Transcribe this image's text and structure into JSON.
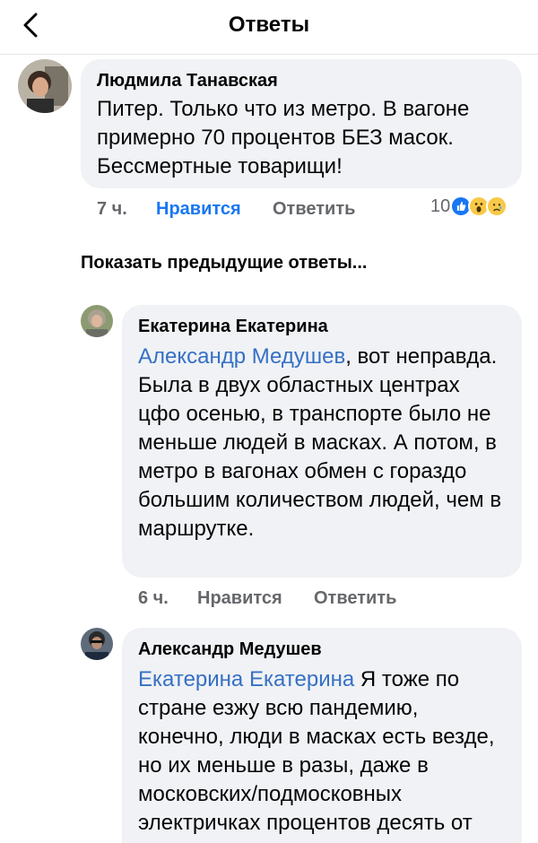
{
  "header": {
    "title": "Ответы",
    "back_icon": "chevron-left-icon"
  },
  "comments": [
    {
      "author": "Людмила Танавская",
      "text": "Питер. Только что из метро. В вагоне примерно 70 процентов БЕЗ масок. Бессмертные товарищи!",
      "time": "7 ч.",
      "like_label": "Нравится",
      "reply_label": "Ответить",
      "reactions_count": "10",
      "reactions": [
        "like",
        "wow",
        "sad"
      ]
    }
  ],
  "show_previous": "Показать предыдущие ответы...",
  "replies": [
    {
      "author": "Екатерина Екатерина",
      "mention": "Александр Медушев",
      "text": ", вот неправда. Была в двух областных центрах цфо осенью, в транспорте было не меньше людей в масках. А потом, в метро в вагонах обмен с гораздо большим количеством людей, чем в маршрутке.",
      "time": "6 ч.",
      "like_label": "Нравится",
      "reply_label": "Ответить"
    },
    {
      "author": "Александр Медушев",
      "mention": "Екатерина Екатерина",
      "text": " Я тоже по стране езжу всю пандемию, конечно, люди в масках есть везде, но их меньше в разы, даже в московских/подмосковных электричках процентов десять от"
    }
  ],
  "colors": {
    "link": "#3670c4",
    "like_active": "#1877f2",
    "bubble": "#f0f2f5",
    "meta": "#65676b"
  }
}
